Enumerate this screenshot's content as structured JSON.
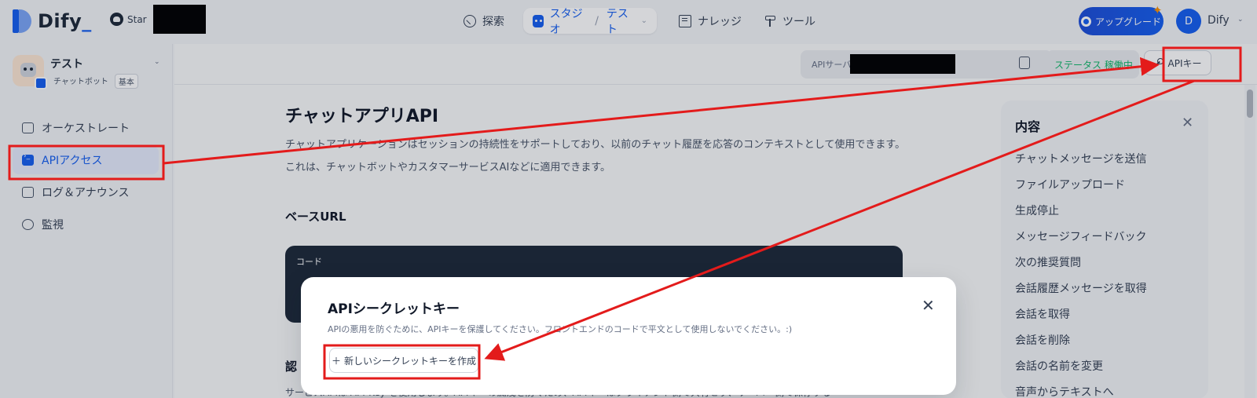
{
  "topnav": {
    "logo_text": "Dify",
    "star_label": "Star",
    "items": [
      {
        "label": "探索",
        "icon": "compass-icon"
      },
      {
        "label": "スタジオ",
        "icon": "robot-icon",
        "crumb": "テスト"
      },
      {
        "label": "ナレッジ",
        "icon": "book-icon"
      },
      {
        "label": "ツール",
        "icon": "tool-icon"
      }
    ],
    "upgrade_label": "アップグレード",
    "avatar_initial": "D",
    "user_name": "Dify"
  },
  "sidebar": {
    "app_name": "テスト",
    "app_type": "チャットボット",
    "app_mode": "基本",
    "items": [
      {
        "label": "オーケストレート"
      },
      {
        "label": "APIアクセス"
      },
      {
        "label": "ログ＆アナウンス"
      },
      {
        "label": "監視"
      }
    ]
  },
  "toolbar": {
    "api_server_label": "APIサーバー",
    "status_label": "ステータス 稼働中",
    "api_key_label": "APIキー"
  },
  "doc": {
    "title": "チャットアプリAPI",
    "desc": "チャットアプリケーションはセッションの持続性をサポートしており、以前のチャット履歴を応答のコンテキストとして使用できます。これは、チャットボットやカスタマーサービスAIなどに適用できます。",
    "base_url_heading": "ベースURL",
    "code_label": "コード",
    "auth_heading": "認",
    "auth_text": "サービスAPIは API-Key を使用します。APIキーの漏洩を防ぐため、APIキーはクライアント側で共有せず、サーバー側で保存する"
  },
  "toc": {
    "title": "内容",
    "items": [
      "チャットメッセージを送信",
      "ファイルアップロード",
      "生成停止",
      "メッセージフィードバック",
      "次の推奨質問",
      "会話履歴メッセージを取得",
      "会話を取得",
      "会話を削除",
      "会話の名前を変更",
      "音声からテキストへ"
    ]
  },
  "modal": {
    "title": "APIシークレットキー",
    "desc": "APIの悪用を防ぐために、APIキーを保護してください。フロントエンドのコードで平文として使用しないでください。:)",
    "create_label": "新しいシークレットキーを作成"
  },
  "colors": {
    "accent": "#155eef",
    "annotation": "#e31b1b",
    "status_green": "#12b76a"
  }
}
